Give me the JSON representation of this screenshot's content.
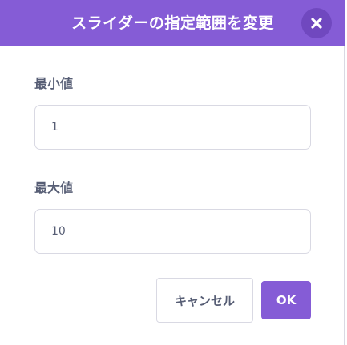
{
  "dialog": {
    "title": "スライダーの指定範囲を変更",
    "close_icon": "close-icon"
  },
  "fields": {
    "min": {
      "label": "最小値",
      "value": "1"
    },
    "max": {
      "label": "最大値",
      "value": "10"
    }
  },
  "buttons": {
    "cancel_label": "キャンセル",
    "ok_label": "OK"
  },
  "colors": {
    "header": "#855cd6",
    "close_bg": "#7048bf",
    "text": "#575e75",
    "border": "#d9d9e3",
    "ok_bg": "#855cd6"
  }
}
